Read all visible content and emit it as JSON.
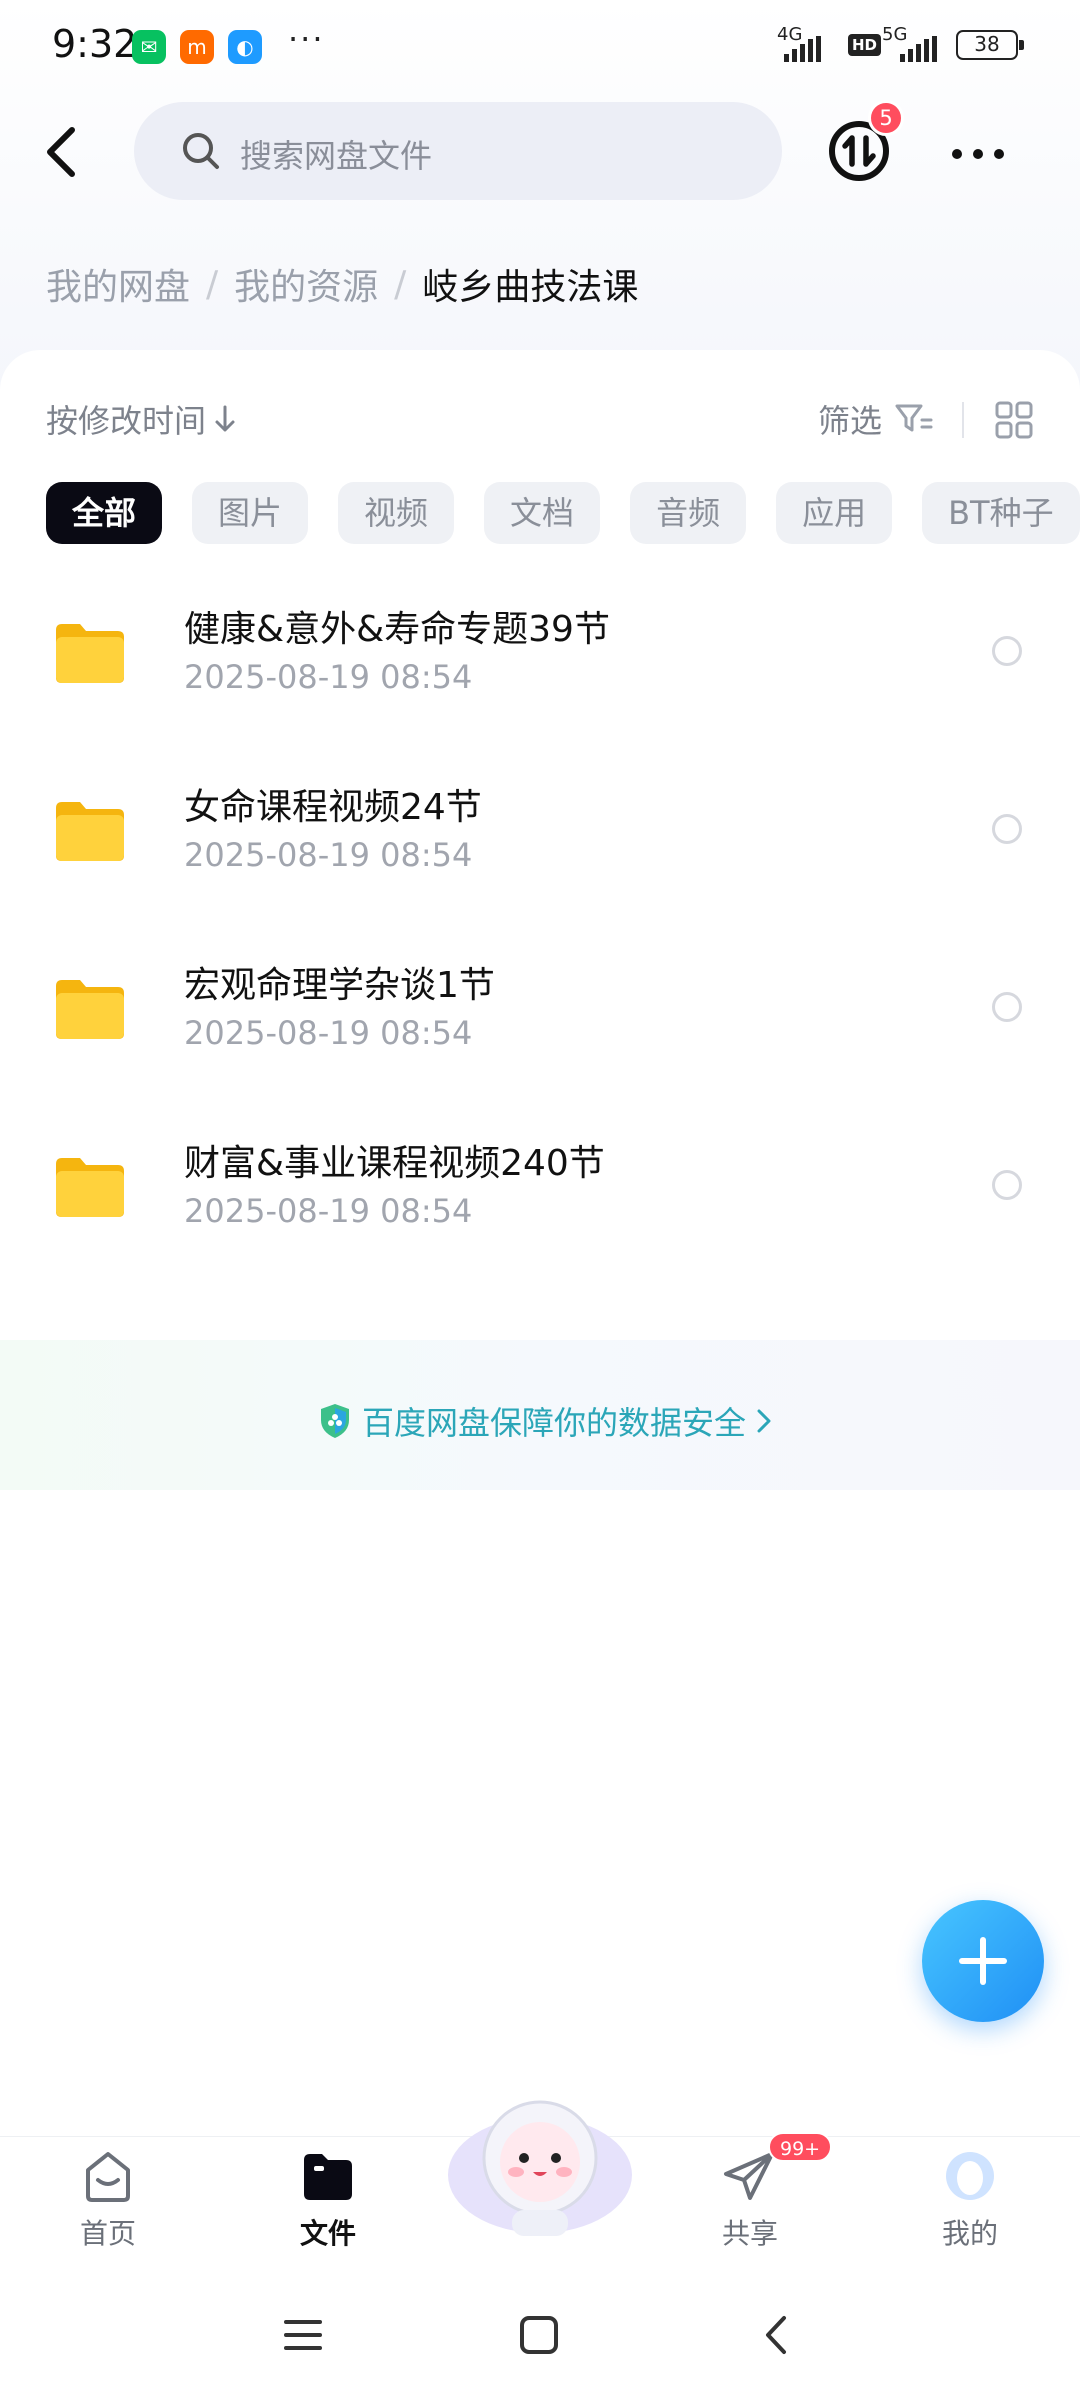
{
  "status_bar": {
    "time": "9:32",
    "more": "···",
    "network_1": "4G",
    "hd": "HD",
    "network_2": "5G",
    "battery": "38"
  },
  "header": {
    "search_placeholder": "搜索网盘文件",
    "transfer_badge": "5"
  },
  "breadcrumb": [
    "我的网盘",
    "我的资源",
    "岐乡曲技法课"
  ],
  "toolbar": {
    "sort_label": "按修改时间",
    "filter_label": "筛选"
  },
  "chips": [
    "全部",
    "图片",
    "视频",
    "文档",
    "音频",
    "应用",
    "BT种子"
  ],
  "active_chip": "全部",
  "files": [
    {
      "name": "健康&意外&寿命专题39节",
      "date": "2025-08-19  08:54"
    },
    {
      "name": "女命课程视频24节",
      "date": "2025-08-19  08:54"
    },
    {
      "name": "宏观命理学杂谈1节",
      "date": "2025-08-19  08:54"
    },
    {
      "name": "财富&事业课程视频240节",
      "date": "2025-08-19  08:54"
    }
  ],
  "security_text": "百度网盘保障你的数据安全",
  "bottom_nav": {
    "home": "首页",
    "files": "文件",
    "share": "共享",
    "share_badge": "99+",
    "mine": "我的"
  },
  "colors": {
    "accent": "#1f8ff5",
    "badge": "#ff4d5e",
    "folder": "#ffcc33",
    "security": "#2ba6b8"
  },
  "icons": [
    "back-icon",
    "search-icon",
    "transfer-icon",
    "more-icon",
    "sort-arrow-icon",
    "filter-icon",
    "grid-view-icon",
    "folder-icon",
    "shield-icon",
    "plus-icon",
    "home-icon",
    "files-icon",
    "share-icon",
    "mine-icon",
    "mascot-icon",
    "menu-icon",
    "home-square-icon",
    "back-nav-icon"
  ]
}
